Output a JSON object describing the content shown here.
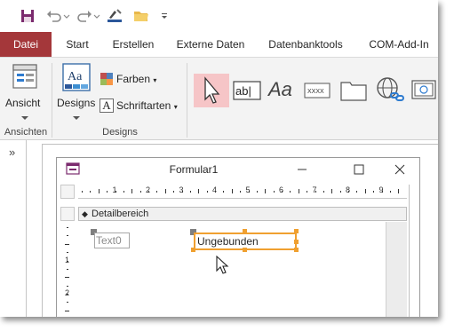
{
  "qat": {
    "items": [
      "save-icon",
      "undo-icon",
      "redo-icon",
      "format-painter-icon",
      "open-folder-icon",
      "customize-icon"
    ]
  },
  "tabs": [
    {
      "label": "Datei",
      "active": false,
      "file": true
    },
    {
      "label": "Start"
    },
    {
      "label": "Erstellen"
    },
    {
      "label": "Externe Daten"
    },
    {
      "label": "Datenbanktools"
    },
    {
      "label": "COM-Add-In"
    }
  ],
  "ribbon": {
    "views": {
      "button": "Ansicht",
      "group": "Ansichten"
    },
    "designs": {
      "designs_button": "Designs",
      "colors_button": "Farben",
      "fonts_button": "Schriftarten",
      "group": "Designs"
    },
    "controls": [
      "select-pointer-icon",
      "textbox-control-icon",
      "label-control-icon",
      "button-control-icon",
      "tab-control-icon",
      "hyperlink-control-icon",
      "web-browser-control-icon"
    ]
  },
  "form": {
    "title": "Formular1",
    "section": "Detailbereich",
    "ruler_numbers": [
      "1",
      "2",
      "3",
      "4",
      "5",
      "6",
      "7",
      "8",
      "9"
    ],
    "vruler_numbers": [
      "1",
      "2"
    ],
    "label_control": "Text0",
    "textbox_control": "Ungebunden"
  },
  "colors": {
    "file_tab": "#a4373a",
    "selection": "#f0a030",
    "hover_tool": "#f6c5c7"
  }
}
